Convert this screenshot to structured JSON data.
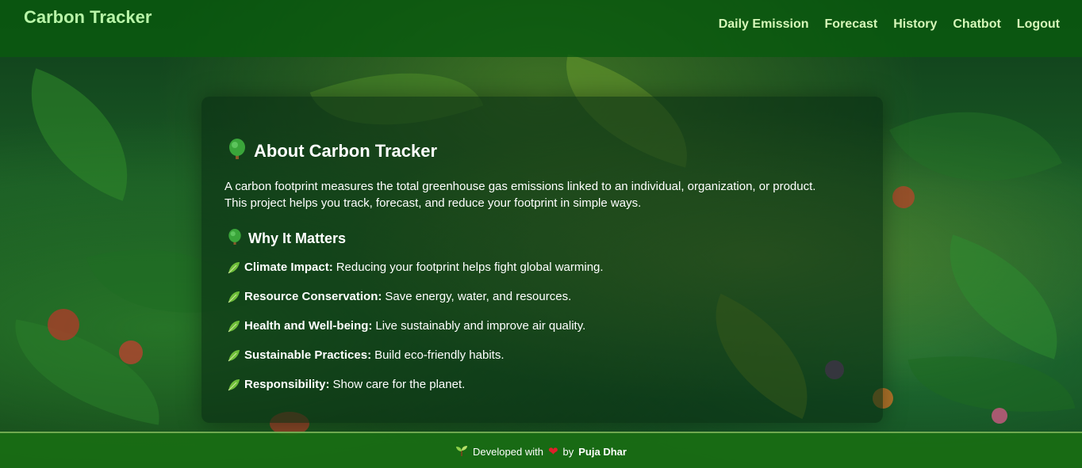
{
  "header": {
    "brand": "Carbon Tracker",
    "nav": [
      "Daily Emission",
      "Forecast",
      "History",
      "Chatbot",
      "Logout"
    ]
  },
  "about": {
    "title": "About Carbon Tracker",
    "title_icon": "tree-icon",
    "intro_line1": "A carbon footprint measures the total greenhouse gas emissions linked to an individual, organization, or product.",
    "intro_line2": "This project helps you track, forecast, and reduce your footprint in simple ways.",
    "why_title": "Why It Matters",
    "why_icon": "tree-icon",
    "points": [
      {
        "label": "Climate Impact:",
        "text": "Reducing your footprint helps fight global warming."
      },
      {
        "label": "Resource Conservation:",
        "text": "Save energy, water, and resources."
      },
      {
        "label": "Health and Well-being:",
        "text": "Live sustainably and improve air quality."
      },
      {
        "label": "Sustainable Practices:",
        "text": "Build eco-friendly habits."
      },
      {
        "label": "Responsibility:",
        "text": "Show care for the planet."
      }
    ],
    "point_icon": "leaf-icon"
  },
  "footer": {
    "prefix": "Developed with",
    "by": "by",
    "author": "Puja Dhar",
    "heart_icon": "heart-icon",
    "seedling_icon": "seedling-icon"
  },
  "colors": {
    "header_bg": "#0a5a0f",
    "brand": "#b8f5a8",
    "nav_link": "#d6f7b9",
    "footer_bg": "#196e14",
    "heart": "#e0202a"
  }
}
